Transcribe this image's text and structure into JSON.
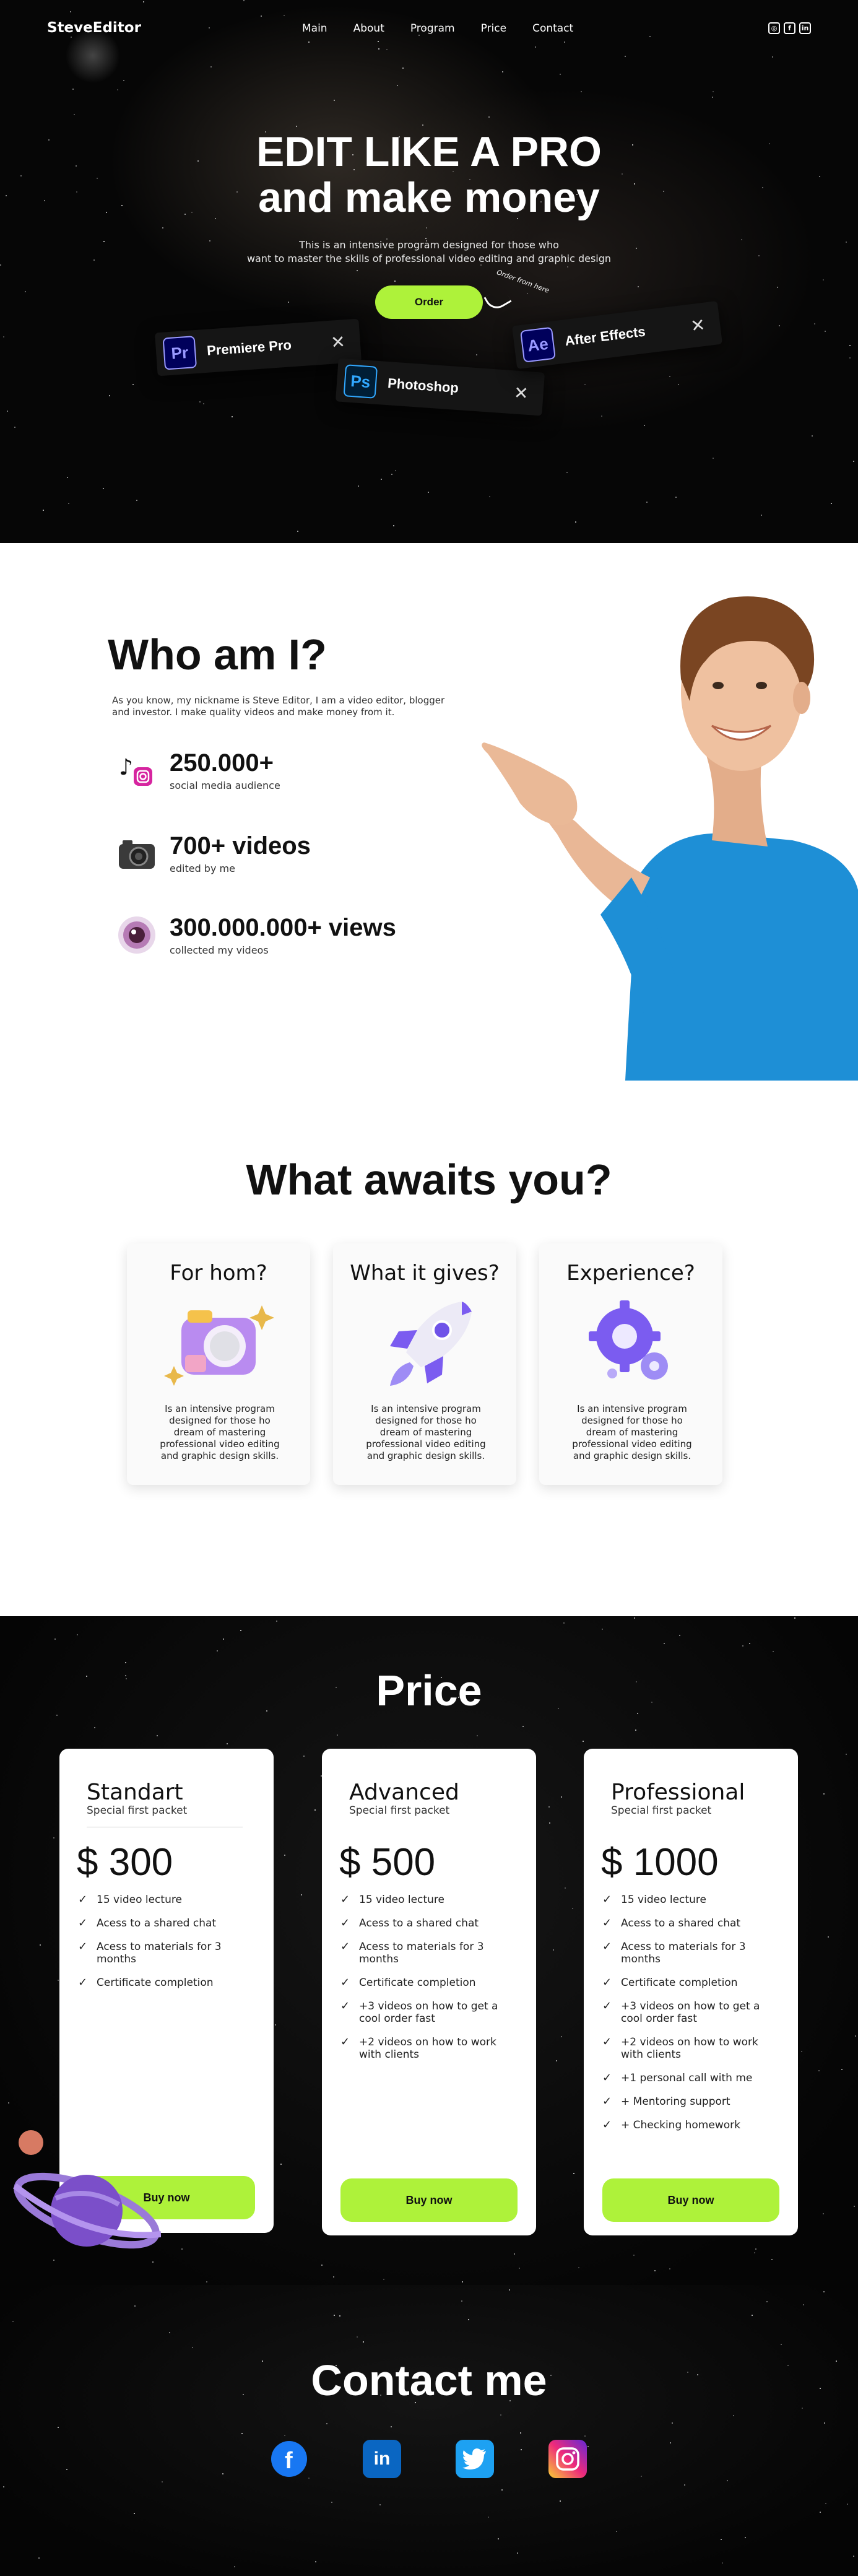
{
  "header": {
    "brand": "SteveEditor",
    "nav": [
      "Main",
      "About",
      "Program",
      "Price",
      "Contact"
    ],
    "social_icons": [
      "instagram-icon",
      "facebook-icon",
      "linkedin-icon"
    ]
  },
  "hero": {
    "title_line1": "EDIT LIKE A PRO",
    "title_line2": "and make money",
    "subtitle_line1": "This is an intensive program designed for those who",
    "subtitle_line2": "want to master the skills of professional video editing and graphic design",
    "order_label": "Order",
    "order_note": "Order from here",
    "apps": [
      {
        "abbr": "Pr",
        "name": "Premiere Pro",
        "color": "#9999ff",
        "bg": "#00005b"
      },
      {
        "abbr": "Ps",
        "name": "Photoshop",
        "color": "#31a8ff",
        "bg": "#001e36"
      },
      {
        "abbr": "Ae",
        "name": "After Effects",
        "color": "#9999ff",
        "bg": "#00005b"
      }
    ]
  },
  "who": {
    "title": "Who am I?",
    "intro": "As you know, my nickname is Steve Editor, I am a video editor, blogger and investor. I make quality videos and make money from it.",
    "stats": [
      {
        "value": "250.000+",
        "label": "social media audience",
        "icon": "tiktok-instagram-icon"
      },
      {
        "value": "700+ videos",
        "label": "edited by me",
        "icon": "camera-icon"
      },
      {
        "value": "300.000.000+ views",
        "label": "collected my videos",
        "icon": "eye-icon"
      }
    ]
  },
  "awaits": {
    "title": "What awaits you?",
    "cards": [
      {
        "title": "For hom?",
        "icon": "camera-3d-icon",
        "text": "Is  an intensive program designed for those ho dream of mastering professional video editing and graphic design skills."
      },
      {
        "title": "What it gives?",
        "icon": "rocket-3d-icon",
        "text": "Is  an intensive program designed for those ho dream of mastering professional video editing and graphic design skills."
      },
      {
        "title": "Experience?",
        "icon": "gears-3d-icon",
        "text": "Is  an intensive program designed for those ho dream of mastering professional video editing and graphic design skills."
      }
    ]
  },
  "price": {
    "title": "Price",
    "plans": [
      {
        "name": "Standart",
        "subtitle": "Special first packet",
        "amount": "$ 300",
        "features": [
          "15 video lecture",
          "Acess to a shared chat",
          "Acess to materials for 3 months",
          "Certificate completion"
        ],
        "button": "Buy now"
      },
      {
        "name": "Advanced",
        "subtitle": "Special first packet",
        "amount": "$ 500",
        "features": [
          "15 video lecture",
          "Acess to a shared chat",
          "Acess to materials for 3 months",
          "Certificate completion",
          "+3 videos on how to get a cool order fast",
          "+2 videos on how to work with clients"
        ],
        "button": "Buy now"
      },
      {
        "name": "Professional",
        "subtitle": "Special first packet",
        "amount": "$ 1000",
        "features": [
          "15 video lecture",
          "Acess to a shared chat",
          "Acess to materials for 3 months",
          "Certificate completion",
          "+3 videos on how to get a cool order fast",
          "+2 videos on how to work with clients",
          "+1 personal call with me",
          "+ Mentoring support",
          "+ Checking homework"
        ],
        "button": "Buy now"
      }
    ]
  },
  "contact": {
    "title": "Contact me",
    "icons": [
      "facebook-icon",
      "linkedin-icon",
      "twitter-icon",
      "instagram-icon"
    ]
  },
  "colors": {
    "accent": "#aef23a",
    "dark_bg": "#060606",
    "light_bg": "#ffffff",
    "shirt_blue": "#1e8fd6"
  }
}
